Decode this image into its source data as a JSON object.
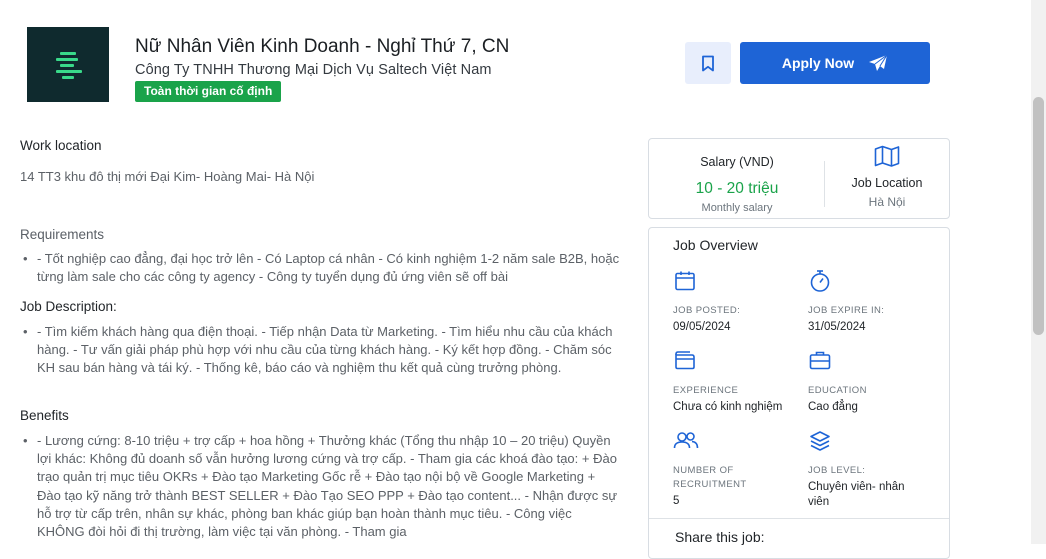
{
  "header": {
    "job_title": "Nữ Nhân Viên Kinh Doanh - Nghỉ Thứ 7, CN",
    "company": "Công Ty TNHH Thương Mại Dịch Vụ Saltech Việt Nam",
    "badge": "Toàn thời gian cố định",
    "apply_label": "Apply Now",
    "bookmark_icon": "bookmark-icon",
    "apply_icon": "paper-plane-icon",
    "accent_color": "#1e64d6",
    "badge_color": "#1aa34a"
  },
  "left": {
    "work_location_title": "Work location",
    "work_location_text": "14 TT3 khu đô thị mới Đại Kim- Hoàng Mai- Hà Nội",
    "requirements_title": "Requirements",
    "requirements_items": [
      "- Tốt nghiệp cao đẳng, đại học trở lên - Có Laptop cá nhân - Có kinh nghiệm 1-2 năm sale B2B, hoặc từng làm sale cho các công ty agency - Công ty tuyển dụng đủ ứng viên sẽ off bài"
    ],
    "job_description_title": "Job Description:",
    "job_description_items": [
      "- Tìm kiếm khách hàng qua điện thoại. - Tiếp nhận Data từ Marketing. - Tìm hiểu nhu cầu của khách hàng. - Tư vấn giải pháp phù hợp với nhu cầu của từng khách hàng. - Ký kết hợp đồng. - Chăm sóc KH sau bán hàng và tái ký. - Thống kê, báo cáo và nghiệm thu kết quả cùng trưởng phòng."
    ],
    "benefits_title": "Benefits",
    "benefits_items": [
      "- Lương cứng: 8-10 triệu + trợ cấp + hoa hồng + Thưởng khác (Tổng thu nhập 10 – 20 triệu) Quyền lợi khác: Không đủ doanh số vẫn hưởng lương cứng và trợ cấp. - Tham gia các khoá đào tạo: + Đào trạo quản trị mục tiêu OKRs + Đào tạo Marketing Gốc rễ + Đào tạo nội bộ về Google Marketing + Đào tạo kỹ năng trở thành BEST SELLER + Đào Tạo SEO PPP + Đào tạo content... - Nhận được sự hỗ trợ từ cấp trên, nhân sự khác, phòng ban khác giúp bạn hoàn thành mục tiêu. - Công việc KHÔNG đòi hỏi đi thị trường, làm việc tại văn phòng. - Tham gia"
    ]
  },
  "salary": {
    "title": "Salary (VND)",
    "value": "10 - 20 triệu",
    "sub": "Monthly salary",
    "location_icon": "map-icon",
    "location_title": "Job Location",
    "location_value": "Hà Nội",
    "value_color": "#1aa34a"
  },
  "overview": {
    "title": "Job Overview",
    "items": [
      {
        "icon": "calendar-icon",
        "label": "JOB POSTED:",
        "value": "09/05/2024"
      },
      {
        "icon": "stopwatch-icon",
        "label": "JOB EXPIRE IN:",
        "value": "31/05/2024"
      },
      {
        "icon": "wallet-icon",
        "label": "EXPERIENCE",
        "value": "Chưa có kinh nghiệm"
      },
      {
        "icon": "briefcase-icon",
        "label": "EDUCATION",
        "value": "Cao đẳng"
      },
      {
        "icon": "people-icon",
        "label": "NUMBER OF RECRUITMENT",
        "value": "5"
      },
      {
        "icon": "layers-icon",
        "label": "JOB LEVEL:",
        "value": "Chuyên viên- nhân viên"
      }
    ],
    "share_title": "Share this job:"
  }
}
